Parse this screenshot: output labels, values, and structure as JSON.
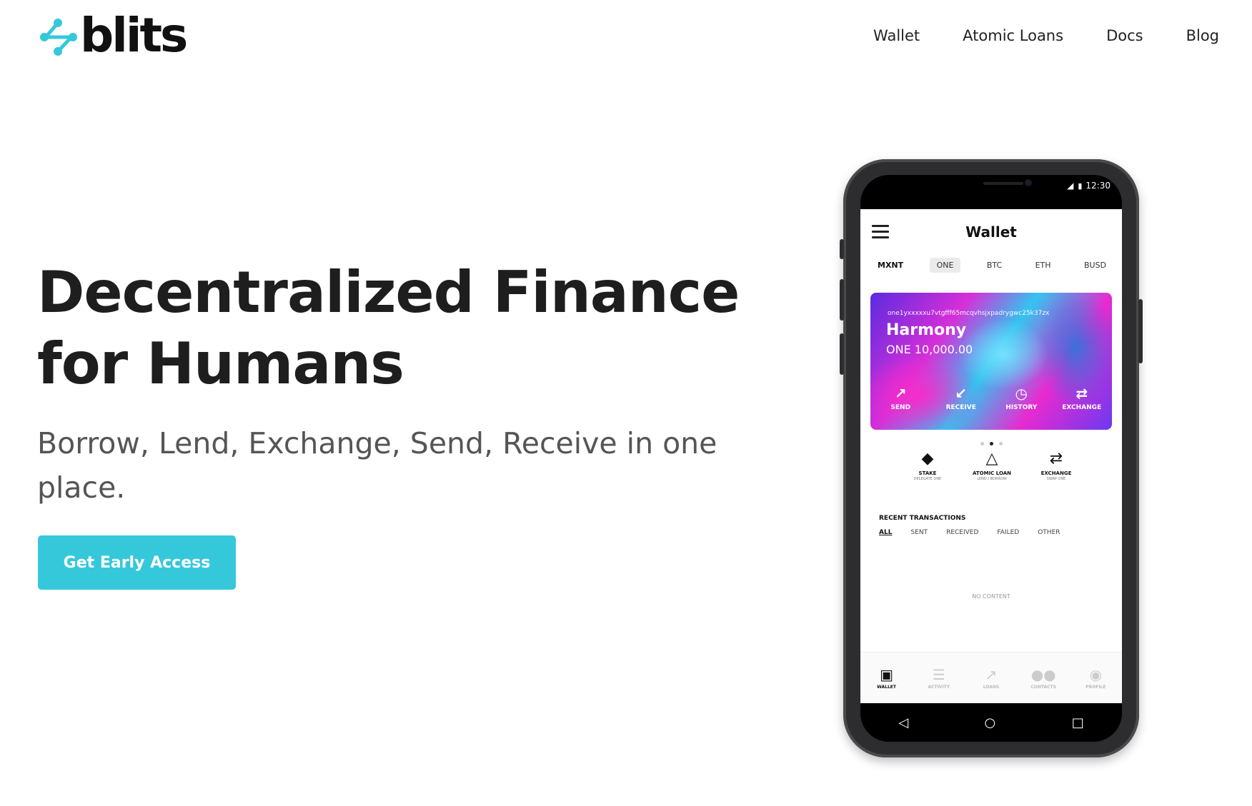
{
  "header": {
    "logo_text": "blits",
    "nav": [
      "Wallet",
      "Atomic Loans",
      "Docs",
      "Blog"
    ]
  },
  "hero": {
    "title_line1": "Decentralized Finance",
    "title_line2": "for Humans",
    "subtitle": "Borrow, Lend, Exchange, Send, Receive in one place.",
    "cta_label": "Get Early Access"
  },
  "colors": {
    "accent": "#35c8db",
    "text": "#1e1e1e",
    "subtitle": "#555555"
  },
  "phone": {
    "status_time": "12:30",
    "app_title": "Wallet",
    "tabs": [
      "MXNT",
      "ONE",
      "BTC",
      "ETH",
      "BUSD"
    ],
    "selected_tab": "ONE",
    "card": {
      "address": "one1yxxxxxu7vtgfff65mcqvhsjxpadrygwc25k37zx",
      "name": "Harmony",
      "balance": "ONE 10,000.00",
      "actions": [
        {
          "label": "SEND",
          "icon": "arrow-up-right-icon"
        },
        {
          "label": "RECEIVE",
          "icon": "arrow-down-left-icon"
        },
        {
          "label": "HISTORY",
          "icon": "clock-icon"
        },
        {
          "label": "EXCHANGE",
          "icon": "swap-icon"
        }
      ]
    },
    "quick_actions": [
      {
        "label": "STAKE",
        "sub": "DELEGATE ONE",
        "icon": "layers-icon"
      },
      {
        "label": "ATOMIC LOAN",
        "sub": "LEND / BORROW",
        "icon": "triangle-icon"
      },
      {
        "label": "EXCHANGE",
        "sub": "SWAP ONE",
        "icon": "swap-icon"
      }
    ],
    "recent_transactions": {
      "title": "RECENT TRANSACTIONS",
      "filters": [
        "ALL",
        "SENT",
        "RECEIVED",
        "FAILED",
        "OTHER"
      ],
      "empty_text": "NO CONTENT"
    },
    "bottom_nav": [
      {
        "label": "WALLET",
        "icon": "wallet-icon"
      },
      {
        "label": "ACTIVITY",
        "icon": "list-icon"
      },
      {
        "label": "LOANS",
        "icon": "trending-up-icon"
      },
      {
        "label": "CONTACTS",
        "icon": "people-icon"
      },
      {
        "label": "PROFILE",
        "icon": "user-circle-icon"
      }
    ]
  }
}
